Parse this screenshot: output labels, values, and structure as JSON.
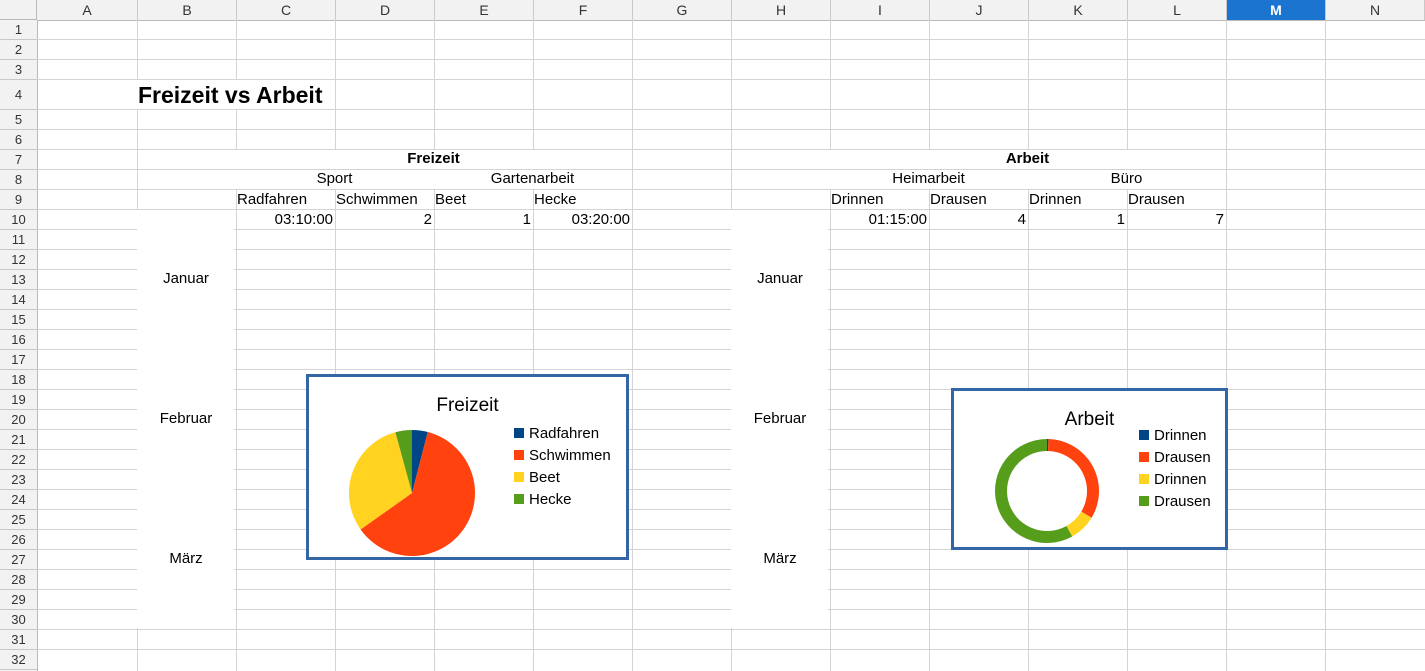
{
  "columns": [
    "A",
    "B",
    "C",
    "D",
    "E",
    "F",
    "G",
    "H",
    "I",
    "J",
    "K",
    "L",
    "M",
    "N"
  ],
  "selected_column": "M",
  "rows": [
    "1",
    "2",
    "3",
    "4",
    "5",
    "6",
    "7",
    "8",
    "9",
    "10",
    "11",
    "12",
    "13",
    "14",
    "15",
    "16",
    "17",
    "18",
    "19",
    "20",
    "21",
    "22",
    "23",
    "24",
    "25",
    "26",
    "27",
    "28",
    "29",
    "30",
    "31",
    "32"
  ],
  "cells": {
    "title": "Freizeit vs Arbeit",
    "freizeit_header": "Freizeit",
    "sport": "Sport",
    "gartenarbeit": "Gartenarbeit",
    "radfahren": "Radfahren",
    "schwimmen": "Schwimmen",
    "beet": "Beet",
    "hecke": "Hecke",
    "radfahren_val": "03:10:00",
    "schwimmen_val": "2",
    "beet_val": "1",
    "hecke_val": "03:20:00",
    "arbeit_header": "Arbeit",
    "heimarbeit": "Heimarbeit",
    "buero": "Büro",
    "heim_drinnen": "Drinnen",
    "heim_drausen": "Drausen",
    "buero_drinnen": "Drinnen",
    "buero_drausen": "Drausen",
    "heim_drinnen_val": "01:15:00",
    "heim_drausen_val": "4",
    "buero_drinnen_val": "1",
    "buero_drausen_val": "7",
    "januar_left": "Januar",
    "februar_left": "Februar",
    "maerz_left": "März",
    "januar_right": "Januar",
    "februar_right": "Februar",
    "maerz_right": "März"
  },
  "chart_data": [
    {
      "type": "pie",
      "title": "Freizeit",
      "categories": [
        "Radfahren",
        "Schwimmen",
        "Beet",
        "Hecke"
      ],
      "values": [
        0.13194,
        2,
        1,
        0.13889
      ],
      "colors": [
        "#004586",
        "#ff420e",
        "#ffd320",
        "#579d1c"
      ],
      "legend": "right"
    },
    {
      "type": "pie",
      "subtype": "donut",
      "title": "Arbeit",
      "categories": [
        "Drinnen",
        "Drausen",
        "Drinnen",
        "Drausen"
      ],
      "values": [
        0.05208,
        4,
        1,
        7
      ],
      "colors": [
        "#004586",
        "#ff420e",
        "#ffd320",
        "#579d1c"
      ],
      "legend": "right"
    }
  ]
}
